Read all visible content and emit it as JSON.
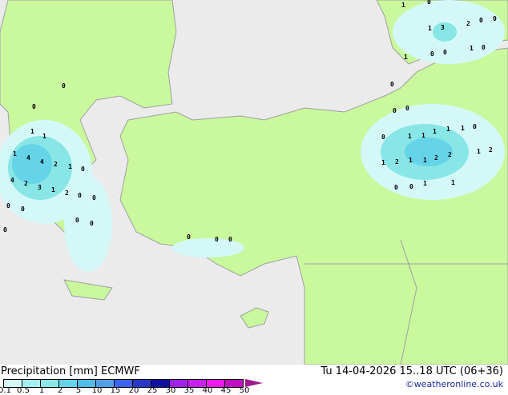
{
  "title": "Precipitation [mm]",
  "model": "ECMWF",
  "valid_time": "Tu 14-04-2026 15..18 UTC (06+36)",
  "credit": "©weatheronline.co.uk",
  "legend": {
    "ticks": [
      "0.1",
      "0.5",
      "1",
      "2",
      "5",
      "10",
      "15",
      "20",
      "25",
      "30",
      "35",
      "40",
      "45",
      "50"
    ],
    "colors": [
      "#d4f8f8",
      "#a4f0f0",
      "#88e6e6",
      "#66d4e8",
      "#50bce8",
      "#50a0e8",
      "#3c64f0",
      "#2838c8",
      "#1010a0",
      "#a020f0",
      "#c820f0",
      "#f018f0",
      "#c010c0"
    ],
    "overflow_color": "#a01890"
  },
  "colors": {
    "land": "#c9f89d",
    "sea": "#ebebeb",
    "border": "#a0a0a0"
  },
  "map_labels": [
    "1",
    "1",
    "1",
    "4",
    "4",
    "2",
    "4",
    "2",
    "3",
    "1",
    "2",
    "1",
    "0",
    "0",
    "0",
    "0",
    "0",
    "0",
    "0",
    "0",
    "0",
    "0",
    "1",
    "1",
    "2",
    "1",
    "1",
    "0",
    "1",
    "2",
    "1",
    "4",
    "2",
    "1",
    "1",
    "1",
    "1",
    "0",
    "0",
    "0",
    "2",
    "1",
    "0",
    "0",
    "1",
    "3",
    "2",
    "0",
    "0",
    "1",
    "0",
    "0",
    "0",
    "1",
    "0",
    "1",
    "0",
    "0",
    "0",
    "0"
  ]
}
